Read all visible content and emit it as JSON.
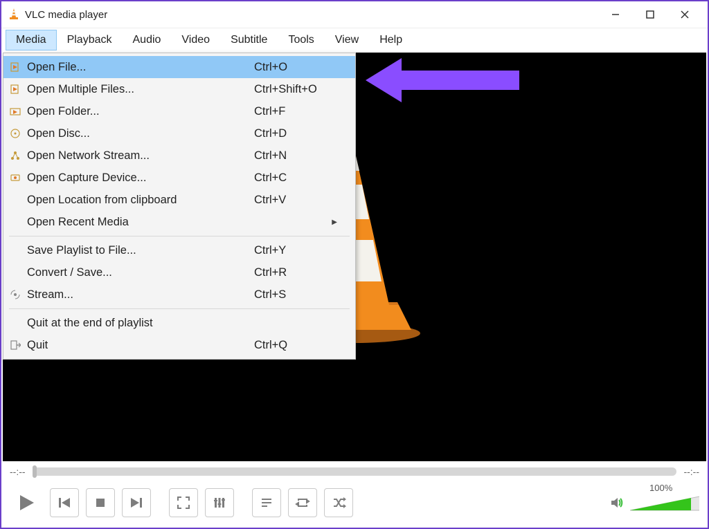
{
  "window": {
    "title": "VLC media player"
  },
  "menubar": [
    "Media",
    "Playback",
    "Audio",
    "Video",
    "Subtitle",
    "Tools",
    "View",
    "Help"
  ],
  "menubar_active_index": 0,
  "dropdown": {
    "hover_index": 0,
    "groups": [
      [
        {
          "icon": "file-play",
          "label": "Open File...",
          "shortcut": "Ctrl+O"
        },
        {
          "icon": "file-play",
          "label": "Open Multiple Files...",
          "shortcut": "Ctrl+Shift+O"
        },
        {
          "icon": "folder-play",
          "label": "Open Folder...",
          "shortcut": "Ctrl+F"
        },
        {
          "icon": "disc",
          "label": "Open Disc...",
          "shortcut": "Ctrl+D"
        },
        {
          "icon": "network",
          "label": "Open Network Stream...",
          "shortcut": "Ctrl+N"
        },
        {
          "icon": "capture",
          "label": "Open Capture Device...",
          "shortcut": "Ctrl+C"
        },
        {
          "icon": "",
          "label": "Open Location from clipboard",
          "shortcut": "Ctrl+V"
        },
        {
          "icon": "",
          "label": "Open Recent Media",
          "shortcut": "",
          "submenu": true
        }
      ],
      [
        {
          "icon": "",
          "label": "Save Playlist to File...",
          "shortcut": "Ctrl+Y"
        },
        {
          "icon": "",
          "label": "Convert / Save...",
          "shortcut": "Ctrl+R"
        },
        {
          "icon": "stream",
          "label": "Stream...",
          "shortcut": "Ctrl+S"
        }
      ],
      [
        {
          "icon": "",
          "label": "Quit at the end of playlist",
          "shortcut": ""
        },
        {
          "icon": "quit",
          "label": "Quit",
          "shortcut": "Ctrl+Q"
        }
      ]
    ]
  },
  "playback": {
    "time_elapsed": "--:--",
    "time_total": "--:--",
    "volume_text": "100%"
  },
  "colors": {
    "accent": "#8a4dff",
    "highlight": "#90c8f6",
    "cone_orange": "#f28c1e",
    "cone_white": "#f4f2ec"
  }
}
